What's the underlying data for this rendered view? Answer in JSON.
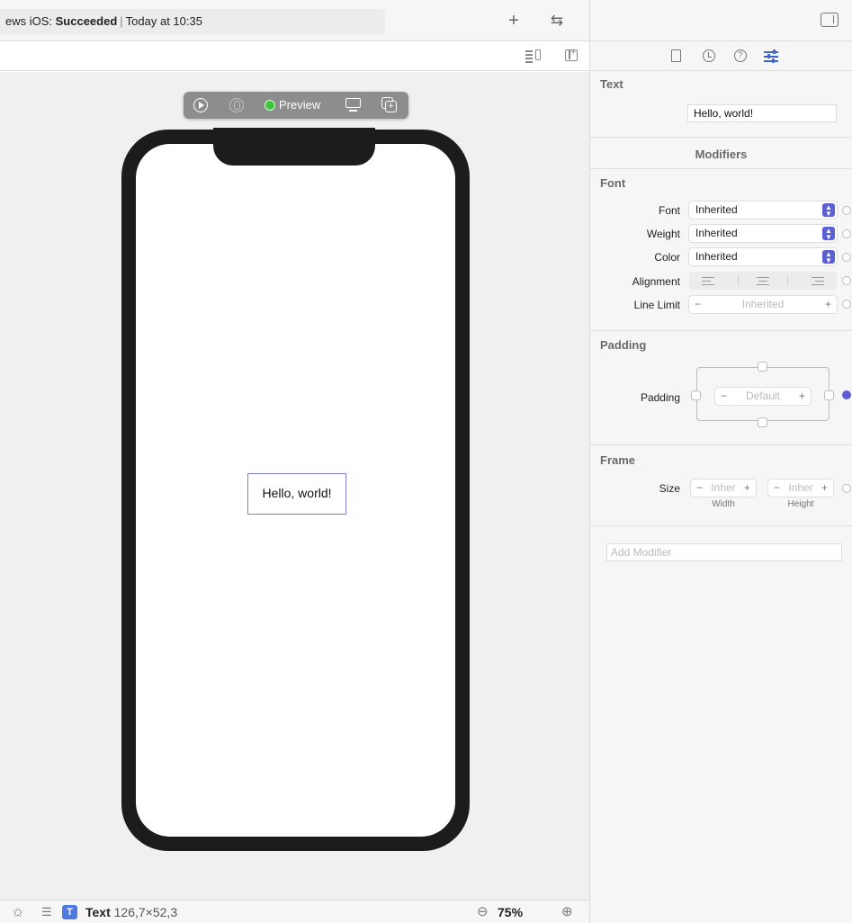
{
  "topbar": {
    "status_prefix": "ews iOS: ",
    "status_bold": "Succeeded",
    "status_sep": "|",
    "status_time": "Today at 10:35",
    "plus": "+",
    "swap": "⇆"
  },
  "preview_toolbar": {
    "preview_label": "Preview"
  },
  "canvas": {
    "hello_text": "Hello, world!"
  },
  "bottombar": {
    "pin": "✩",
    "modifier": "☰",
    "type_badge": "T",
    "selection_name": "Text",
    "selection_dims": "126,7×52,3",
    "zoom_out": "⊖",
    "zoom_level": "75%",
    "zoom_in": "⊕"
  },
  "inspector": {
    "text_section": "Text",
    "text_value": "Hello, world!",
    "modifiers_title": "Modifiers",
    "font_section": "Font",
    "font_label": "Font",
    "font_value": "Inherited",
    "weight_label": "Weight",
    "weight_value": "Inherited",
    "color_label": "Color",
    "color_value": "Inherited",
    "alignment_label": "Alignment",
    "line_limit_label": "Line Limit",
    "line_limit_value": "Inherited",
    "minus": "−",
    "plus": "+",
    "padding_section": "Padding",
    "padding_label": "Padding",
    "padding_value": "Default",
    "frame_section": "Frame",
    "size_label": "Size",
    "width_value": "Inher",
    "height_value": "Inher",
    "width_caption": "Width",
    "height_caption": "Height",
    "add_modifier_placeholder": "Add Modifier"
  },
  "colors": {
    "accent": "#5b5fd2",
    "selection_border": "#7d7fd6",
    "preview_green": "#3cc43c",
    "type_badge": "#4d7ae1"
  }
}
